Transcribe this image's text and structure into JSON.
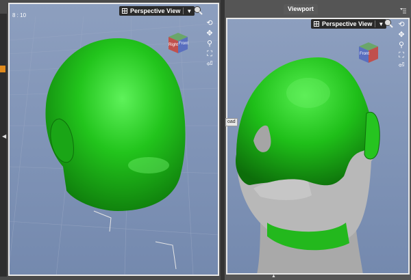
{
  "left_viewport": {
    "corner_readout": "8 : 10",
    "view_label": "Perspective View",
    "dropdown_caret": "▼",
    "cube_faces": {
      "front": "Front",
      "side": "Right"
    }
  },
  "right_viewport": {
    "tab_label": "Viewport",
    "view_label": "Perspective View",
    "dropdown_caret": "▼",
    "cube_faces": {
      "front": "Front"
    },
    "side_tag": "oad"
  },
  "icons": {
    "orbit": "orbit-icon",
    "pan": "pan-icon",
    "zoom": "zoom-icon",
    "frame": "frame-icon",
    "reset": "reset-icon"
  },
  "colors": {
    "model_green": "#22c41c",
    "model_gray": "#b8b8b8",
    "viewport_bg": "#8496b8",
    "panel_dark": "#3f3f3f"
  }
}
